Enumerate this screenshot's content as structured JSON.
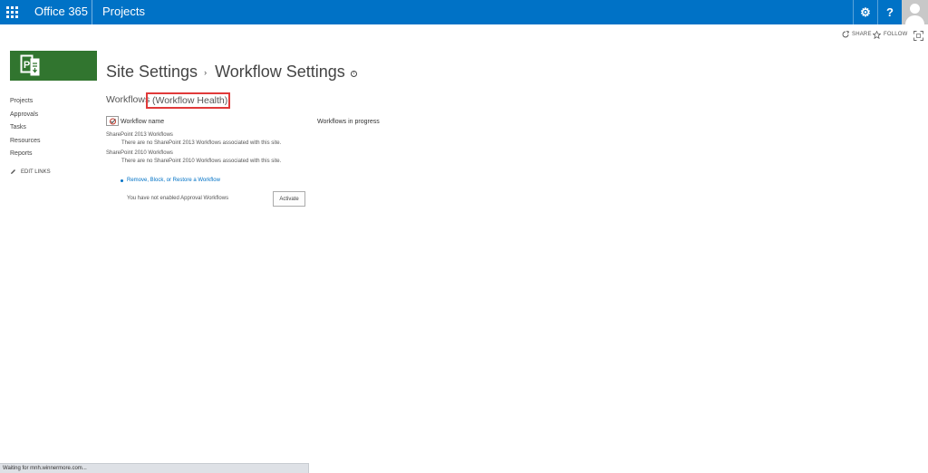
{
  "suite_bar": {
    "brand": "Office 365",
    "app_name": "Projects",
    "settings_glyph": "⚙",
    "help_glyph": "?",
    "bg_color": "#0072c6"
  },
  "ribbon": {
    "share_label": "SHARE",
    "follow_label": "FOLLOW",
    "icons": [
      "share-icon",
      "follow-star-icon",
      "focus-icon"
    ]
  },
  "logo": {
    "bg_color": "#31752f",
    "icon": "project-logo-icon"
  },
  "page_title": {
    "parent": "Site Settings",
    "separator": "›",
    "current": "Workflow Settings",
    "info_glyph": "i"
  },
  "left_nav": {
    "items": [
      {
        "label": "Projects"
      },
      {
        "label": "Approvals"
      },
      {
        "label": "Tasks"
      },
      {
        "label": "Resources"
      },
      {
        "label": "Reports"
      }
    ],
    "edit_links": "EDIT LINKS"
  },
  "main": {
    "heading": "Workflows",
    "health_link": "(Workflow Health)",
    "highlight_color": "#e03a3a",
    "col_name": "Workflow name",
    "col_progress": "Workflows in progress",
    "groups": [
      {
        "title": "SharePoint 2013 Workflows",
        "empty_text": "There are no SharePoint 2013 Workflows associated with this site."
      },
      {
        "title": "SharePoint 2010 Workflows",
        "empty_text": "There are no SharePoint 2010 Workflows associated with this site."
      }
    ],
    "remove_link": "Remove, Block, or Restore a Workflow",
    "approval_text": "You have not enabled Approval Workflows",
    "activate_label": "Activate"
  },
  "status_bar": {
    "text": "Waiting for mnh.winnermore.com..."
  }
}
